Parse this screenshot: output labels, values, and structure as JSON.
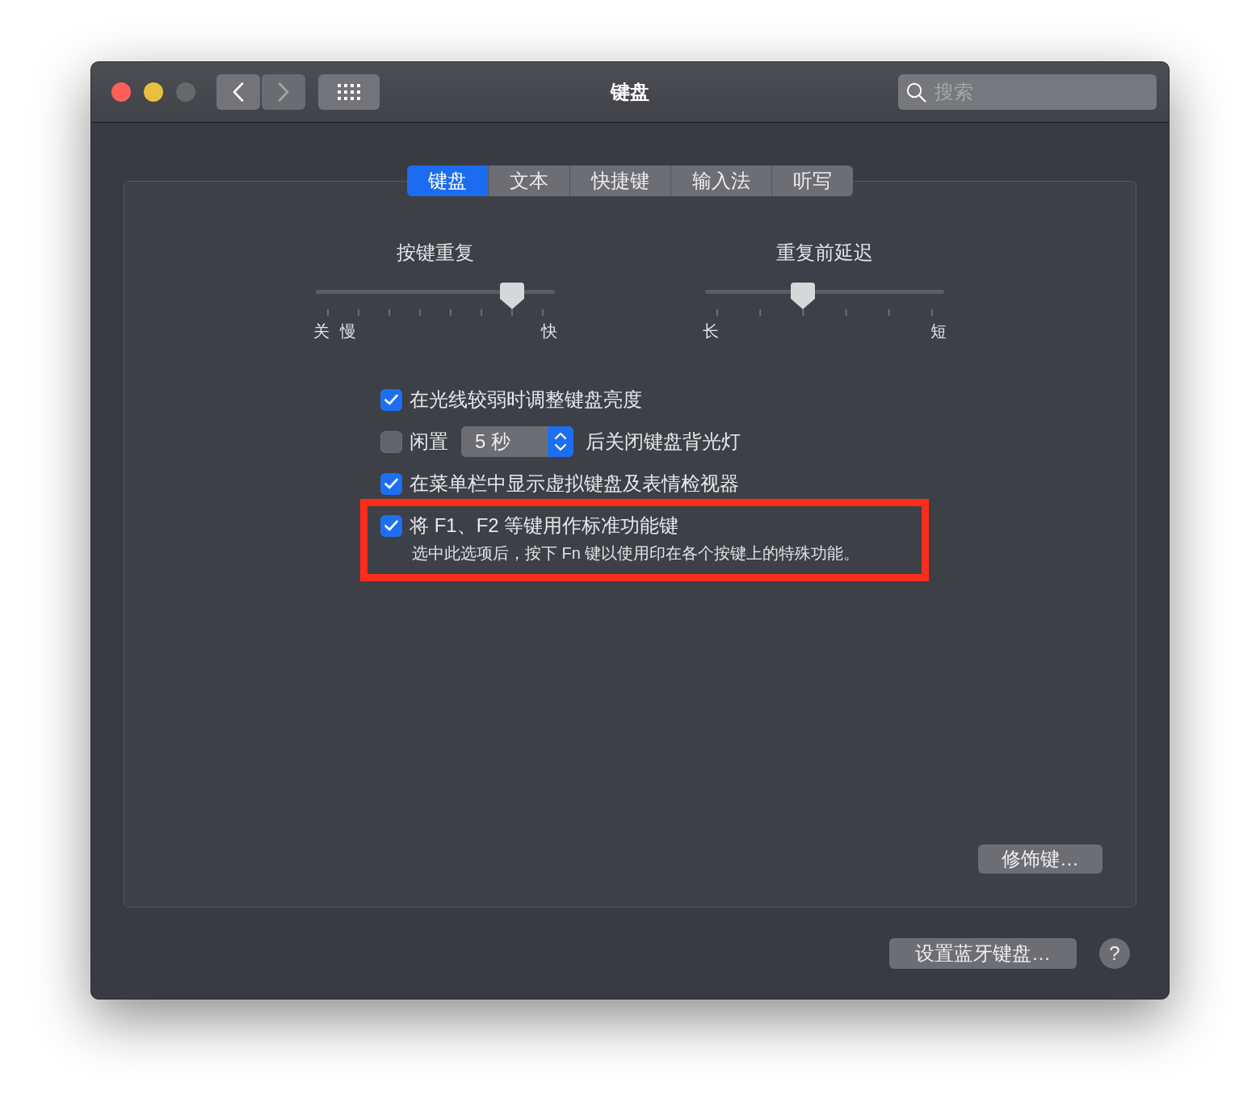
{
  "window": {
    "title": "键盘",
    "traffic_lights": [
      {
        "kind": "close",
        "disabled": false
      },
      {
        "kind": "minimize",
        "disabled": false
      },
      {
        "kind": "zoom",
        "disabled": true
      }
    ]
  },
  "toolbar": {
    "nav_buttons": [
      {
        "kind": "back",
        "disabled": false
      },
      {
        "kind": "forward",
        "disabled": true
      },
      {
        "kind": "grid",
        "disabled": false
      }
    ]
  },
  "search": {
    "placeholder": "搜索"
  },
  "tabs": [
    {
      "label": "键盘",
      "selected": true
    },
    {
      "label": "文本",
      "selected": false
    },
    {
      "label": "快捷键",
      "selected": false
    },
    {
      "label": "输入法",
      "selected": false
    },
    {
      "label": "听写",
      "selected": false
    }
  ],
  "sliders": [
    {
      "kind": "rate",
      "title": "按键重复",
      "level": 0.857,
      "left_labels": [
        "关",
        "慢"
      ],
      "right_label": "快"
    },
    {
      "kind": "delay",
      "title": "重复前延迟",
      "level": 0.4,
      "left_labels": [
        "长"
      ],
      "right_label": "短"
    }
  ],
  "options": [
    {
      "kind": "check",
      "checked": true,
      "label": "在光线较弱时调整键盘亮度",
      "highlighted": false
    },
    {
      "kind": "timeout",
      "checked": false,
      "label": "闲置",
      "popup": "5 秒",
      "suffix": "后关闭键盘背光灯",
      "highlighted": false
    },
    {
      "kind": "check",
      "checked": true,
      "label": "在菜单栏中显示虚拟键盘及表情检视器",
      "highlighted": false
    },
    {
      "kind": "check",
      "checked": true,
      "label": "将 F1、F2 等键用作标准功能键",
      "note": "选中此选项后，按下 Fn 键以使用印在各个按键上的特殊功能。",
      "highlighted": true
    }
  ],
  "panel_button": "修饰键…",
  "footer": {
    "button": "设置蓝牙键盘…",
    "help": "?"
  }
}
